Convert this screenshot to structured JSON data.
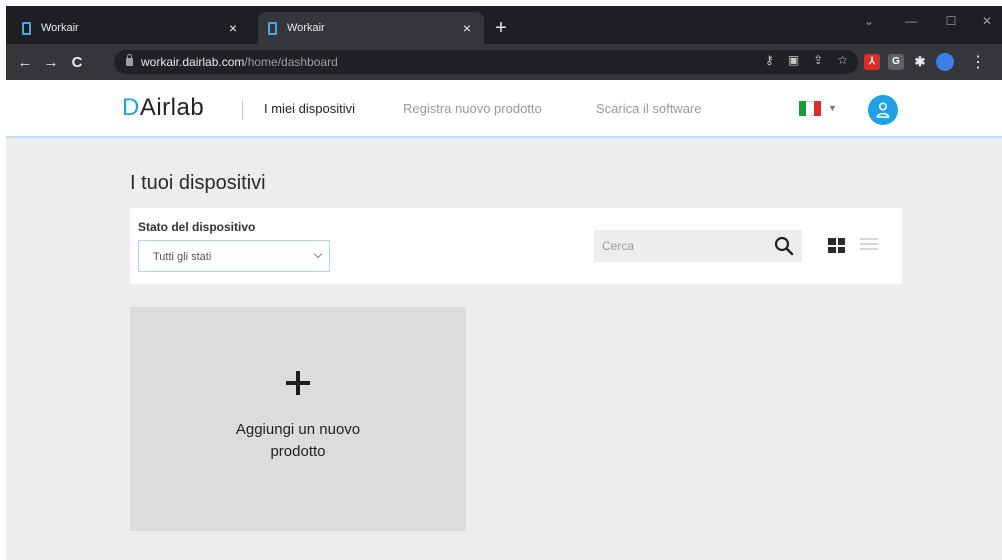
{
  "browser": {
    "tabs": [
      {
        "title": "Workair",
        "close": "×",
        "active": false
      },
      {
        "title": "Workair",
        "close": "×",
        "active": true
      }
    ],
    "new_tab": "+",
    "nav": {
      "back": "←",
      "forward": "→",
      "reload": "C"
    },
    "address": {
      "host": "workair.dairlab.com",
      "path": "/home/dashboard"
    },
    "window_controls": [
      "⌄",
      "—",
      "☐",
      "✕"
    ]
  },
  "app": {
    "logo": {
      "mark": "D",
      "rest": "Airlab"
    },
    "nav": [
      {
        "label": "I miei dispositivi",
        "active": true
      },
      {
        "label": "Registra nuovo prodotto",
        "active": false
      },
      {
        "label": "Scarica il software",
        "active": false
      }
    ],
    "language_flag": {
      "colors": [
        "#1c9b3c",
        "#ffffff",
        "#e02b2b"
      ]
    },
    "accent_color": "#1ea1e6"
  },
  "main": {
    "title": "I tuoi dispositivi",
    "filter": {
      "label": "Stato del dispositivo",
      "selected": "Tutti gli stati"
    },
    "search": {
      "placeholder": "Cerca"
    },
    "add_card": {
      "line1": "Aggiungi un nuovo",
      "line2": "prodotto"
    }
  }
}
